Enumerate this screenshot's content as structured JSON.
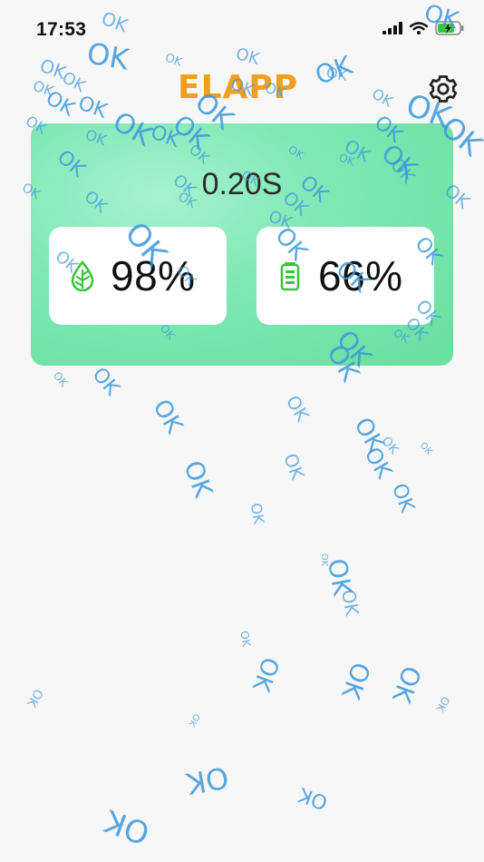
{
  "status_bar": {
    "time": "17:53"
  },
  "app": {
    "logo": "ELAPP"
  },
  "panel": {
    "timer": "0.20S",
    "humidity": {
      "value": "98%",
      "icon": "droplet-icon"
    },
    "battery": {
      "value": "66%",
      "icon": "battery-icon"
    }
  },
  "overlay": {
    "text": "OK"
  },
  "colors": {
    "accent": "#f0a020",
    "card_green": "#7fe8b5",
    "ok_blue": "#3d97db",
    "icon_green": "#3cc43c"
  }
}
